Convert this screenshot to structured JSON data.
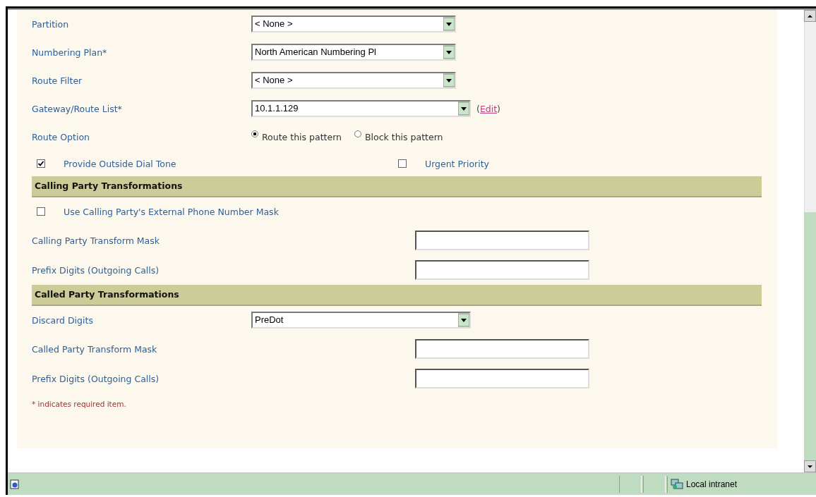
{
  "form": {
    "rows": [
      {
        "kind": "select",
        "label": "Partition",
        "value": "< None >"
      },
      {
        "kind": "select",
        "label": "Numbering Plan*",
        "value": "North American Numbering Pl"
      },
      {
        "kind": "select",
        "label": "Route Filter",
        "value": "< None >"
      },
      {
        "kind": "wideselect",
        "label": "Gateway/Route List*",
        "value": "10.1.1.129",
        "link_open": "(",
        "link": "Edit",
        "link_close": ")"
      },
      {
        "kind": "radio",
        "label": "Route Option",
        "options": [
          {
            "label": "Route this pattern",
            "selected": true
          },
          {
            "label": "Block this pattern",
            "selected": false
          }
        ]
      },
      {
        "kind": "checkbox_pair",
        "options": [
          {
            "label": "Provide Outside Dial Tone",
            "checked": true
          },
          {
            "label": "Urgent Priority",
            "checked": false
          }
        ]
      },
      {
        "kind": "header",
        "label": "Calling Party Transformations"
      },
      {
        "kind": "checkbox",
        "label": "Use Calling Party's External Phone Number Mask",
        "checked": false
      },
      {
        "kind": "text",
        "label": "Calling Party Transform Mask"
      },
      {
        "kind": "text",
        "label": "Prefix Digits (Outgoing Calls)"
      },
      {
        "kind": "header",
        "label": "Called Party Transformations"
      },
      {
        "kind": "wideselect",
        "label": "Discard Digits",
        "value": "PreDot"
      },
      {
        "kind": "text",
        "label": "Called Party Transform Mask"
      },
      {
        "kind": "text",
        "label": "Prefix Digits (Outgoing Calls)"
      },
      {
        "kind": "note",
        "label": "* indicates required item."
      }
    ]
  },
  "status_bar": {
    "zone": "Local intranet"
  }
}
